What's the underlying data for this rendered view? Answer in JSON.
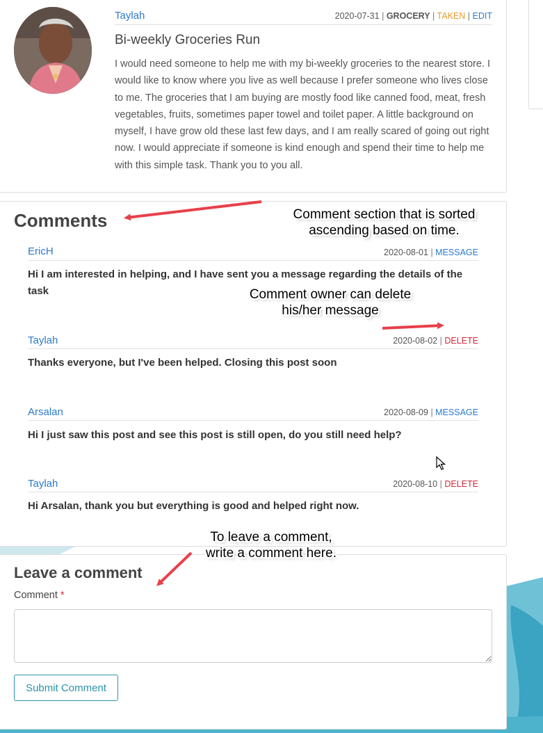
{
  "post": {
    "author": "Taylah",
    "date": "2020-07-31",
    "category": "GROCERY",
    "status": "TAKEN",
    "edit_label": "EDIT",
    "title": "Bi-weekly Groceries Run",
    "body": "I would need someone to help me with my bi-weekly groceries to the nearest store. I would like to know where you live as well because I prefer someone who lives close to me. The groceries that I am buying are mostly food like canned food, meat, fresh vegetables, fruits, sometimes paper towel and toilet paper. A little background on myself, I have grow old these last few days, and I am really scared of going out right now. I would appreciate if someone is kind enough and spend their time to help me with this simple task. Thank you to you all."
  },
  "comments": {
    "heading": "Comments",
    "items": [
      {
        "author": "EricH",
        "date": "2020-08-01",
        "action": "MESSAGE",
        "text": "Hi I am interested in helping, and I have sent you a message regarding the details of the task"
      },
      {
        "author": "Taylah",
        "date": "2020-08-02",
        "action": "DELETE",
        "text": "Thanks everyone, but I've been helped. Closing this post soon"
      },
      {
        "author": "Arsalan",
        "date": "2020-08-09",
        "action": "MESSAGE",
        "text": "Hi I just saw this post and see this post is still open, do you still need help?"
      },
      {
        "author": "Taylah",
        "date": "2020-08-10",
        "action": "DELETE",
        "text": "Hi Arsalan, thank you but everything is good and helped right now."
      }
    ]
  },
  "leave_comment": {
    "heading": "Leave a comment",
    "field_label": "Comment",
    "required_mark": "*",
    "submit_label": "Submit Comment"
  },
  "annotations": {
    "sorted": "Comment section that is sorted ascending  based on time.",
    "delete": "Comment owner can delete his/her message",
    "leave": "To leave a comment, write a comment here."
  },
  "colors": {
    "link": "#2c7ac9",
    "taken": "#e89a2c",
    "delete": "#d6283a",
    "button": "#2a93a8",
    "arrow": "#e8404a"
  }
}
